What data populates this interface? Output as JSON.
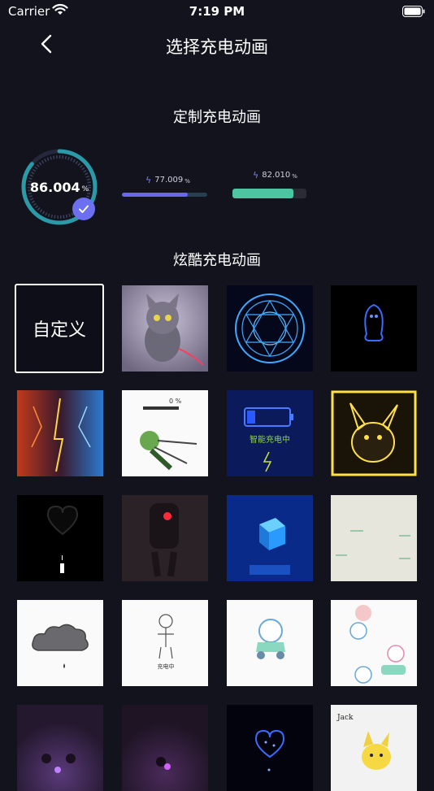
{
  "status_bar": {
    "carrier": "Carrier",
    "time": "7:19 PM"
  },
  "nav": {
    "title": "选择充电动画",
    "back_icon": "chevron-left-icon"
  },
  "custom_section": {
    "title": "定制充电动画",
    "ring": {
      "value": "86.004",
      "unit": "%",
      "progress": 0.86,
      "color": "#2a9aa8"
    },
    "bars": [
      {
        "value": "77.009",
        "unit": "%",
        "progress": 0.77,
        "fill_color": "#6a68e6",
        "track_color": "#2a3e52"
      },
      {
        "value": "82.010",
        "unit": "%",
        "progress": 0.82,
        "fill_color": "#4cc5a0",
        "track_color": "#2b2b36"
      }
    ]
  },
  "cool_section": {
    "title": "炫酷充电动画",
    "custom_tile_label": "自定义",
    "tiles": [
      {
        "name": "tile-gray-cat"
      },
      {
        "name": "tile-blue-magic-circle"
      },
      {
        "name": "tile-neon-penguin"
      },
      {
        "name": "tile-flash-hero"
      },
      {
        "name": "tile-sword-anime"
      },
      {
        "name": "tile-neon-battery",
        "text": "智能充电中"
      },
      {
        "name": "tile-glowing-pikachu"
      },
      {
        "name": "tile-neon-heart"
      },
      {
        "name": "tile-red-eye-robot"
      },
      {
        "name": "tile-blue-cube"
      },
      {
        "name": "tile-grass-paper"
      },
      {
        "name": "tile-sad-cloud"
      },
      {
        "name": "tile-doodle-figure",
        "text": "充电中"
      },
      {
        "name": "tile-cartoon-scooter"
      },
      {
        "name": "tile-cartoon-characters"
      },
      {
        "name": "tile-dark-room-1"
      },
      {
        "name": "tile-dark-room-2"
      },
      {
        "name": "tile-blue-heart-particles"
      },
      {
        "name": "tile-pikachu-sketch",
        "text": "Jack"
      }
    ]
  }
}
